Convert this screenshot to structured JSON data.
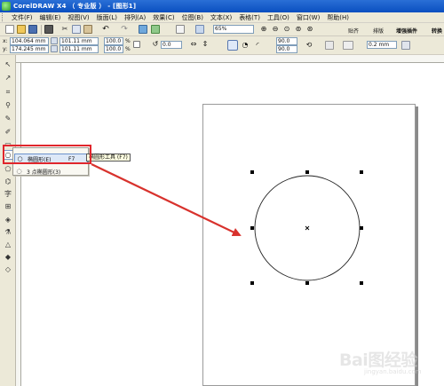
{
  "window": {
    "title": "CorelDRAW X4 （ 专业版 ） - [图形1]"
  },
  "menu": {
    "items": [
      "文件(F)",
      "编辑(E)",
      "视图(V)",
      "版面(L)",
      "排列(A)",
      "效果(C)",
      "位图(B)",
      "文本(X)",
      "表格(T)",
      "工具(O)",
      "窗口(W)",
      "帮助(H)"
    ]
  },
  "toolbar": {
    "zoom": "65%",
    "snap_label": "贴齐",
    "welcome_label": "排版",
    "enhance_label": "增强插件",
    "convert_label": "转换"
  },
  "property_bar": {
    "x": "104.064 mm",
    "y": "174.245 mm",
    "width": "101.11 mm",
    "height": "101.11 mm",
    "scale_x": "100.0",
    "scale_y": "100.0",
    "pct": "%",
    "rotation": "0.0",
    "arc_start": "90.0",
    "arc_end": "90.0",
    "outline": "0.2 mm",
    "x_label": "x:",
    "y_label": "y:"
  },
  "flyout": {
    "items": [
      {
        "label": "椭圆形(E)",
        "shortcut": "F7"
      },
      {
        "label": "3 点椭圆形(3)",
        "shortcut": ""
      }
    ],
    "tooltip": "椭圆形工具 (F7)"
  },
  "watermark": {
    "text": "Bai图经验",
    "sub": "jingyan.baidu.com"
  },
  "colors": {
    "highlight_red": "#e0262c",
    "arrow_red": "#d8322d",
    "title_blue": "#0a4fc0",
    "chrome": "#ece9d8"
  }
}
